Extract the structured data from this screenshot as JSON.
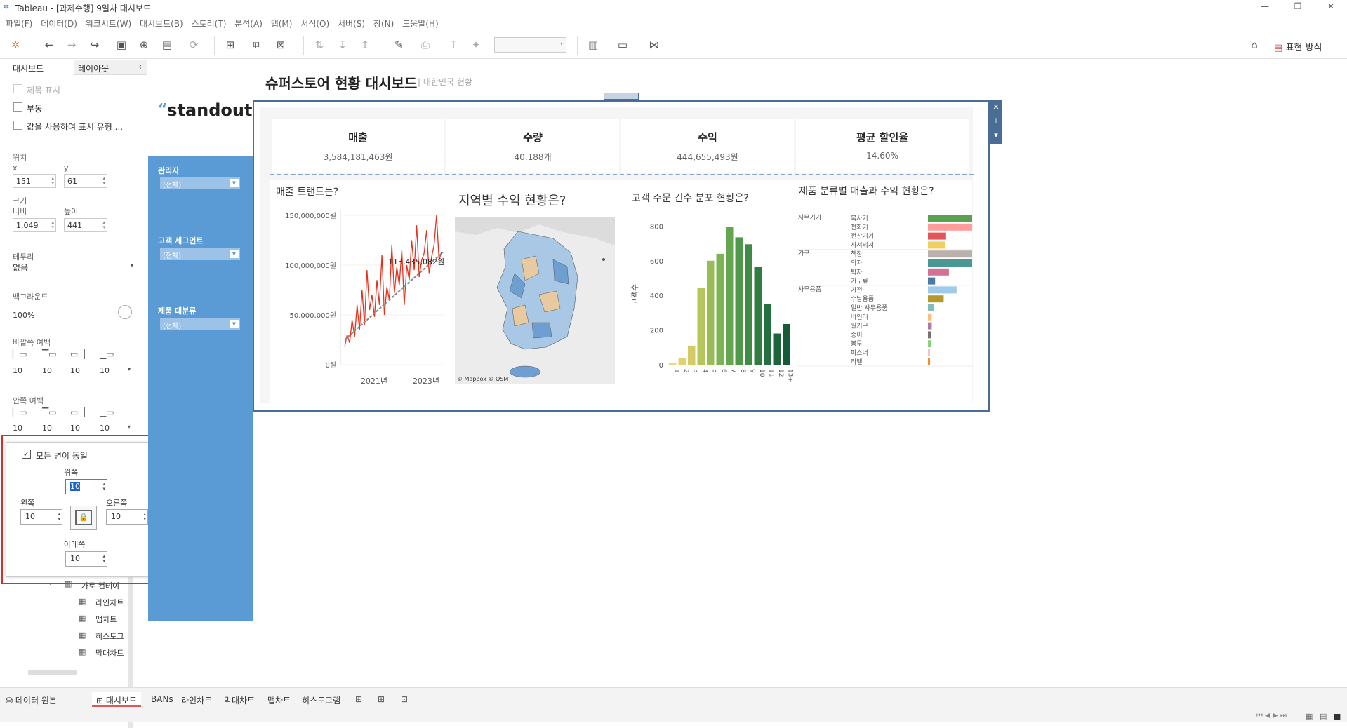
{
  "window": {
    "title": "Tableau - [과제수행] 9일차 대시보드"
  },
  "menu": [
    "파일(F)",
    "데이터(D)",
    "워크시트(W)",
    "대시보드(B)",
    "스토리(T)",
    "분석(A)",
    "맵(M)",
    "서식(O)",
    "서버(S)",
    "창(N)",
    "도움말(H)"
  ],
  "toolbar": {
    "show_me": "표현 방식"
  },
  "left_panel": {
    "tabs": [
      "대시보드",
      "레이아웃"
    ],
    "show_title": "제목 표시",
    "floating": "부동",
    "use_value": "값을 사용하여 표시 유형 ...",
    "position_label": "위치",
    "x_label": "x",
    "y_label": "y",
    "x": "151",
    "y": "61",
    "size_label": "크기",
    "width_label": "너비",
    "height_label": "높이",
    "width": "1,049",
    "height": "441",
    "border_label": "테두리",
    "border_value": "없음",
    "background_label": "백그라운드",
    "background_value": "100%",
    "outer_padding_label": "바깥쪽 여백",
    "outer_padding": [
      "10",
      "10",
      "10",
      "10"
    ],
    "inner_padding_label": "안쪽 여백",
    "inner_padding": [
      "10",
      "10",
      "10",
      "10"
    ],
    "tree_items": [
      "가로 컨테이",
      "라인차트",
      "맵차트",
      "히스토그",
      "막대차트"
    ]
  },
  "padding_popup": {
    "all_sides": "모든 변이 동일",
    "top_label": "위쪽",
    "top": "10",
    "left_label": "왼쪽",
    "left": "10",
    "right_label": "오른쪽",
    "right": "10",
    "bottom_label": "아래쪽",
    "bottom": "10"
  },
  "dashboard": {
    "logo": "standout",
    "title": "슈퍼스토어 현황 대시보드",
    "subtitle": "대한민국 현황",
    "filters": [
      {
        "label": "관리자",
        "value": "(전체)"
      },
      {
        "label": "고객 세그먼트",
        "value": "(전체)"
      },
      {
        "label": "제품 대분류",
        "value": "(전체)"
      }
    ],
    "bans": [
      {
        "title": "매출",
        "value": "3,584,181,463원"
      },
      {
        "title": "수량",
        "value": "40,188개"
      },
      {
        "title": "수익",
        "value": "444,655,493원"
      },
      {
        "title": "평균 할인율",
        "value": "14.60%"
      }
    ],
    "map": {
      "title": "지역별 수익 현황은?",
      "credit": "© Mapbox © OSM"
    }
  },
  "chart_data": [
    {
      "type": "line",
      "title": "매출 트랜드는?",
      "xlabel": "",
      "ylabel": "",
      "yticks": [
        "150,000,000원",
        "100,000,000원",
        "50,000,000원",
        "0원"
      ],
      "xticks": [
        "2021년",
        "2023년"
      ],
      "ylim": [
        0,
        150000000
      ],
      "annotation": "113,435,082원",
      "series": [
        {
          "values": [
            18,
            30,
            22,
            45,
            28,
            60,
            35,
            75,
            40,
            95,
            55,
            70,
            48,
            85,
            60,
            110,
            50,
            78,
            65,
            120,
            72,
            98,
            80,
            115,
            60,
            100,
            85,
            125,
            95,
            140,
            88,
            105,
            112,
            135,
            92,
            108,
            120,
            150,
            105,
            113
          ]
        }
      ],
      "trend": [
        25,
        113
      ]
    },
    {
      "type": "bar",
      "title": "고객 주문 건수 분포 현황은?",
      "ylabel": "고객수",
      "categories": [
        "1",
        "2",
        "3",
        "4",
        "5",
        "6",
        "7",
        "8",
        "9",
        "10",
        "11",
        "12",
        "13+"
      ],
      "values": [
        8,
        40,
        110,
        445,
        600,
        640,
        795,
        735,
        695,
        565,
        350,
        180,
        235
      ],
      "yticks": [
        "800",
        "600",
        "400",
        "200",
        "0"
      ],
      "ylim": [
        0,
        850
      ]
    },
    {
      "type": "bar",
      "title": "제품 분류별 매출과 수익 현황은?",
      "groups": [
        {
          "name": "사무기기",
          "items": [
            {
              "label": "복사기",
              "value": 95,
              "color": "#59a14f"
            },
            {
              "label": "전화기",
              "value": 95,
              "color": "#ff9d9a"
            },
            {
              "label": "전산기기",
              "value": 38,
              "color": "#e15759"
            },
            {
              "label": "사서비서",
              "value": 36,
              "color": "#f1ce63"
            }
          ]
        },
        {
          "name": "가구",
          "items": [
            {
              "label": "책장",
              "value": 100,
              "color": "#bab0ac"
            },
            {
              "label": "의자",
              "value": 100,
              "color": "#499894"
            },
            {
              "label": "탁자",
              "value": 44,
              "color": "#d37295"
            },
            {
              "label": "가구류",
              "value": 15,
              "color": "#4e79a7"
            }
          ]
        },
        {
          "name": "사무용품",
          "items": [
            {
              "label": "가전",
              "value": 60,
              "color": "#a0cbe8"
            },
            {
              "label": "수납용품",
              "value": 33,
              "color": "#b6992d"
            },
            {
              "label": "일반 사무용품",
              "value": 12,
              "color": "#86bcb6"
            },
            {
              "label": "바인더",
              "value": 8,
              "color": "#ffbe7d"
            },
            {
              "label": "필기구",
              "value": 8,
              "color": "#b07aa1"
            },
            {
              "label": "종이",
              "value": 7,
              "color": "#79706e"
            },
            {
              "label": "봉투",
              "value": 6,
              "color": "#8cd17d"
            },
            {
              "label": "파스너",
              "value": 4,
              "color": "#fabfd2"
            },
            {
              "label": "라벨",
              "value": 3,
              "color": "#f28e2b"
            }
          ]
        }
      ]
    }
  ],
  "sheet_tabs": [
    "데이터 원본",
    "대시보드",
    "BANs",
    "라인차트",
    "막대차트",
    "맵차트",
    "히스토그램"
  ]
}
